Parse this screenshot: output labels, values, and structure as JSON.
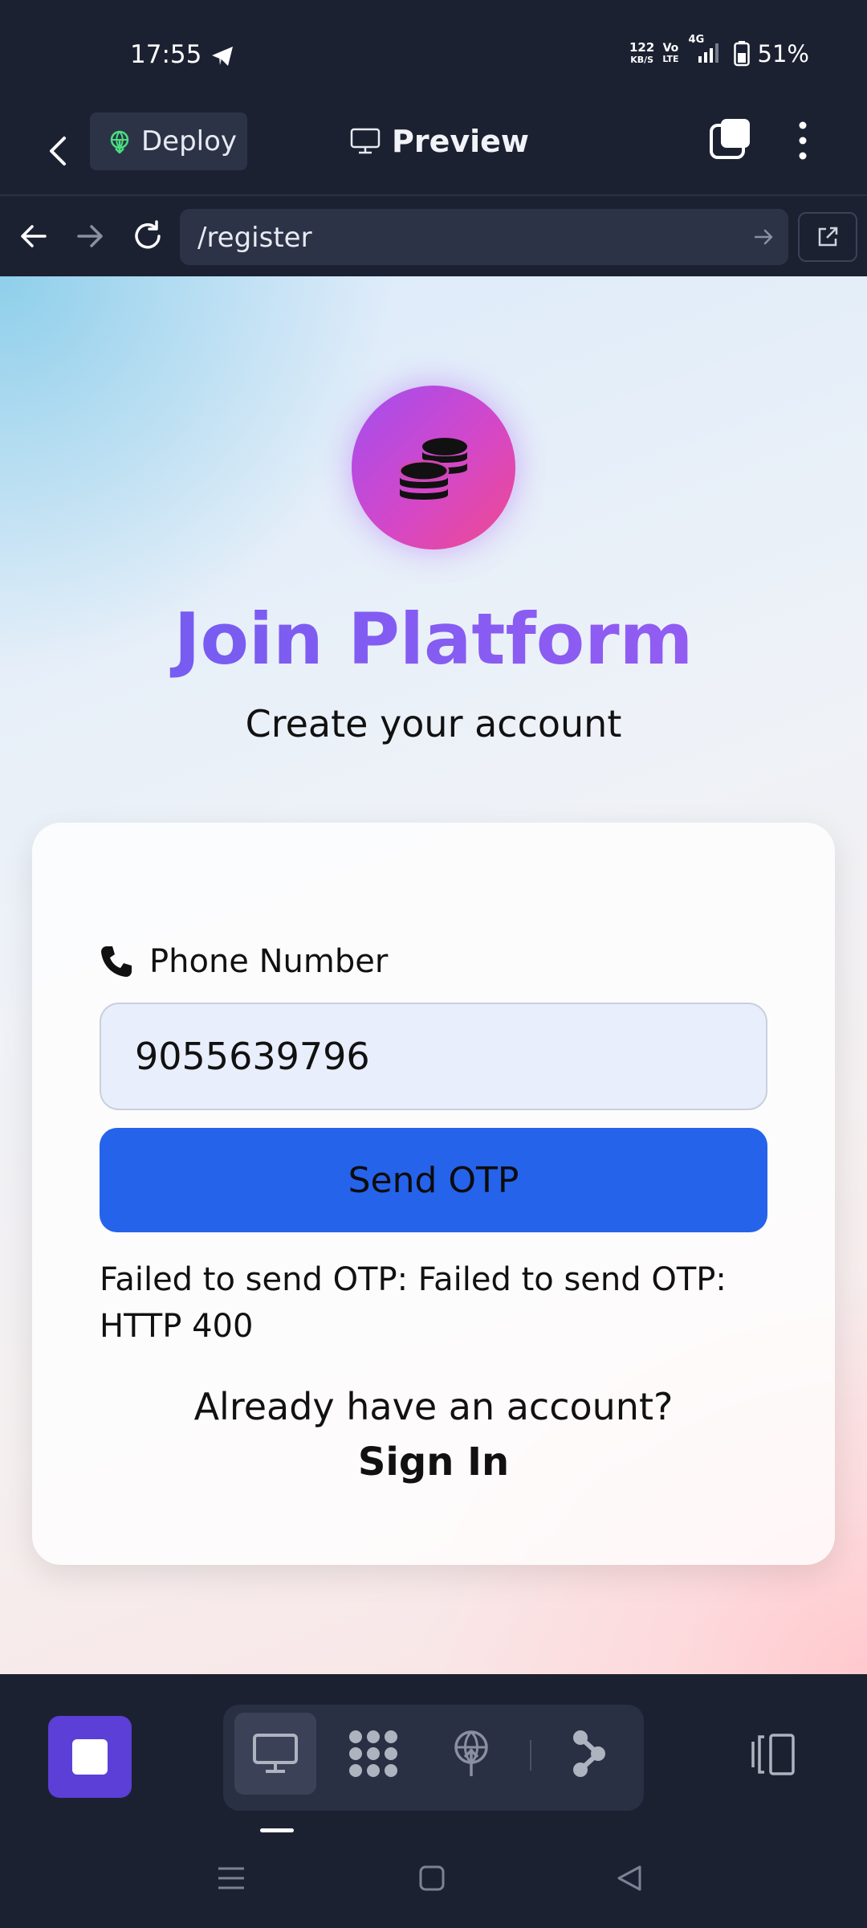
{
  "status_bar": {
    "time": "17:55",
    "net_speed_value": "122",
    "net_speed_unit": "KB/S",
    "volte_top": "Vo",
    "volte_bottom": "LTE",
    "network": "4G",
    "battery": "51%"
  },
  "app_bar": {
    "deploy_label": "Deploy",
    "preview_label": "Preview"
  },
  "browser": {
    "url": "/register"
  },
  "page": {
    "title": "Join Platform",
    "subtitle": "Create your account",
    "phone_label": "Phone Number",
    "phone_value": "9055639796",
    "send_otp_label": "Send OTP",
    "error_message": "Failed to send OTP: Failed to send OTP: HTTP 400",
    "already_text": "Already have an account?",
    "sign_in_label": "Sign In"
  },
  "colors": {
    "primary_button": "#2563eb",
    "title_gradient_start": "#6d5cf0",
    "logo_gradient_start": "#a24ef0",
    "logo_gradient_end": "#ef4a8e",
    "stop_button": "#5b3fd6",
    "chrome_background": "#1c2132"
  },
  "icons": {
    "status": [
      "telegram-send-icon",
      "signal-icon",
      "battery-icon"
    ],
    "app_bar": [
      "back-icon",
      "globe-icon",
      "monitor-icon",
      "tabs-icon",
      "more-vert-icon"
    ],
    "browser": [
      "arrow-back-icon",
      "arrow-forward-icon",
      "reload-icon",
      "go-arrow-icon",
      "open-external-icon"
    ],
    "page": [
      "coins-icon",
      "phone-icon"
    ],
    "toolbar": [
      "stop-icon",
      "desktop-icon",
      "apps-icon",
      "deploy-globe-icon",
      "branch-icon",
      "layout-icon"
    ],
    "nav": [
      "menu-icon",
      "home-icon",
      "back-triangle-icon"
    ]
  }
}
